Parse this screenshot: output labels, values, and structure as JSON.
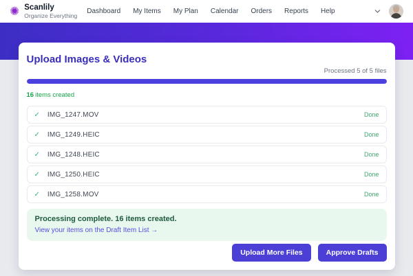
{
  "brand": {
    "name": "Scanlily",
    "tagline": "Organize Everything",
    "logo_glyph": "✺",
    "logo_color": "#8b27cc"
  },
  "nav": {
    "items": [
      {
        "label": "Dashboard"
      },
      {
        "label": "My Items"
      },
      {
        "label": "My Plan"
      },
      {
        "label": "Calendar"
      },
      {
        "label": "Orders"
      },
      {
        "label": "Reports"
      },
      {
        "label": "Help"
      }
    ]
  },
  "panel": {
    "title": "Upload Images & Videos",
    "processed_label": "Processed 5 of 5 files",
    "progress_percent": 100,
    "created_count": "16",
    "created_label": "items created",
    "check_icon": "✓",
    "files": [
      {
        "name": "IMG_1247.MOV",
        "status": "Done"
      },
      {
        "name": "IMG_1249.HEIC",
        "status": "Done"
      },
      {
        "name": "IMG_1248.HEIC",
        "status": "Done"
      },
      {
        "name": "IMG_1250.HEIC",
        "status": "Done"
      },
      {
        "name": "IMG_1258.MOV",
        "status": "Done"
      }
    ],
    "completion": {
      "message": "Processing complete. 16 items created.",
      "link_label": "View your items on the Draft Item List",
      "link_arrow": "→"
    },
    "buttons": {
      "upload_more": "Upload More Files",
      "approve": "Approve Drafts"
    }
  },
  "colors": {
    "accent": "#4c3fd6",
    "brand_purple": "#8b27cc",
    "hero_gradient_start": "#3c2ec5",
    "hero_gradient_end": "#7d21f3",
    "success_green": "#16a34a",
    "progress_bar": "#4b40dd"
  }
}
